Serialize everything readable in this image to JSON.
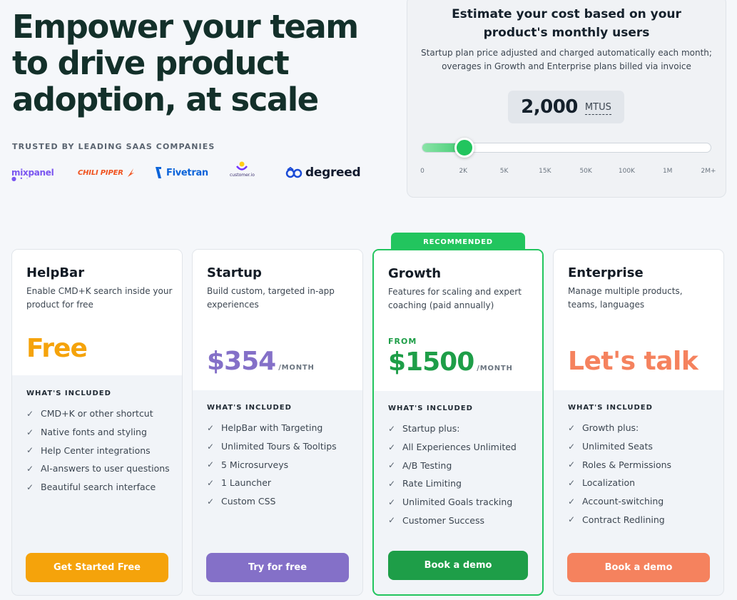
{
  "hero": {
    "title": "Empower your team to drive product adoption, at scale",
    "trusted_label": "TRUSTED BY LEADING SAAS COMPANIES",
    "logos": {
      "mixpanel": "mixpanel",
      "chilipiper": "CHILI PIPER",
      "fivetran": "Fivetran",
      "customerio": "customer.io",
      "degreed": "degreed"
    }
  },
  "estimator": {
    "title": "Estimate your cost based on your product's monthly users",
    "subtitle": "Startup plan price adjusted and charged automatically each month; overages in Growth and Enterprise plans billed via invoice",
    "mtu_value": "2,000",
    "mtu_unit": "MTUS",
    "slider_position": 0.147,
    "ticks": [
      "0",
      "2K",
      "5K",
      "15K",
      "50K",
      "100K",
      "1M",
      "2M+"
    ]
  },
  "plans": [
    {
      "name": "HelpBar",
      "description": "Enable CMD+K search inside your product for free",
      "from_label": "",
      "price": "Free",
      "period": "",
      "included_label": "WHAT'S INCLUDED",
      "features": [
        "CMD+K or other shortcut",
        "Native fonts and styling",
        "Help Center integrations",
        "AI-answers to user questions",
        "Beautiful search interface"
      ],
      "cta": "Get Started Free",
      "accent": "#f5a30b"
    },
    {
      "name": "Startup",
      "description": "Build custom, targeted in-app experiences",
      "from_label": "",
      "price": "$354",
      "period": "/MONTH",
      "included_label": "WHAT'S INCLUDED",
      "features": [
        "HelpBar with Targeting",
        "Unlimited Tours & Tooltips",
        "5 Microsurveys",
        "1 Launcher",
        "Custom CSS"
      ],
      "cta": "Try for free",
      "accent": "#8470c8"
    },
    {
      "name": "Growth",
      "description": "Features for scaling and expert coaching (paid annually)",
      "from_label": "FROM",
      "price": "$1500",
      "period": "/MONTH",
      "included_label": "WHAT'S INCLUDED",
      "features": [
        "Startup plus:",
        "All Experiences Unlimited",
        "A/B Testing",
        "Rate Limiting",
        "Unlimited Goals tracking",
        "Customer Success"
      ],
      "cta": "Book a demo",
      "accent": "#1e9e48",
      "badge": "RECOMMENDED"
    },
    {
      "name": "Enterprise",
      "description": "Manage multiple products, teams, languages",
      "from_label": "",
      "price": "Let's talk",
      "period": "",
      "included_label": "WHAT'S INCLUDED",
      "features": [
        "Growth plus:",
        "Unlimited Seats",
        "Roles & Permissions",
        "Localization",
        "Account-switching",
        "Contract Redlining"
      ],
      "cta": "Book a demo",
      "accent": "#f5825e"
    }
  ]
}
